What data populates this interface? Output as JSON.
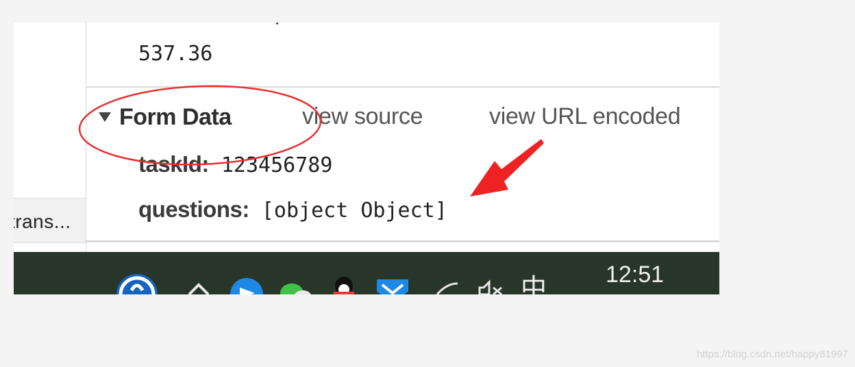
{
  "devtools": {
    "top_value": "537.36",
    "left_tab_label": "trans...",
    "form_data": {
      "title": "Form Data",
      "view_source_label": "view source",
      "view_url_encoded_label": "view URL encoded",
      "fields": [
        {
          "key": "taskId:",
          "value": "123456789"
        },
        {
          "key": "questions:",
          "value": "[object Object]"
        }
      ]
    }
  },
  "taskbar": {
    "clock": "12:51",
    "background": "#283529",
    "tray_icons": [
      "help-icon",
      "chevron-up-icon",
      "send-icon",
      "wechat-icon",
      "qq-icon",
      "shield-icon",
      "wifi-icon",
      "volume-muted-icon",
      "ime-icon"
    ],
    "ime_label": "中"
  },
  "annotation": {
    "color": "#e53030",
    "shapes": [
      "ellipse",
      "arrow"
    ]
  },
  "watermark": "https://blog.csdn.net/happy81997"
}
